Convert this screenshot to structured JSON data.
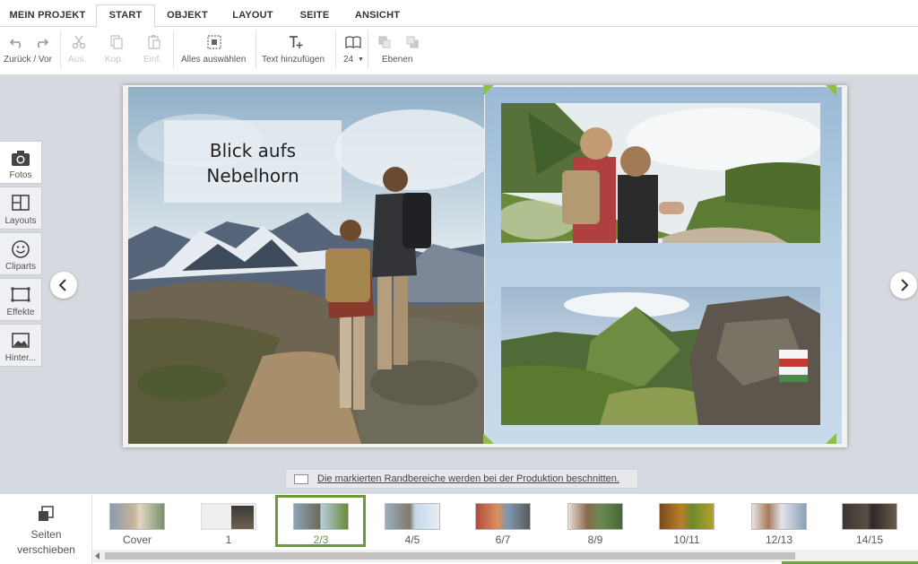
{
  "menu": {
    "tabs": [
      {
        "label": "MEIN PROJEKT",
        "active": false
      },
      {
        "label": "START",
        "active": true
      },
      {
        "label": "OBJEKT",
        "active": false
      },
      {
        "label": "LAYOUT",
        "active": false
      },
      {
        "label": "SEITE",
        "active": false
      },
      {
        "label": "ANSICHT",
        "active": false
      }
    ]
  },
  "toolbar": {
    "undo_redo_label": "Zurück / Vor",
    "cut_label": "Aus.",
    "copy_label": "Kop.",
    "paste_label": "Einf.",
    "select_all_label": "Alles auswählen",
    "add_text_label": "Text hinzufügen",
    "font_size_value": "24",
    "layers_label": "Ebenen"
  },
  "side_panel": {
    "items": [
      {
        "label": "Fotos",
        "icon": "camera-icon",
        "active": true
      },
      {
        "label": "Layouts",
        "icon": "layouts-icon",
        "active": false
      },
      {
        "label": "Cliparts",
        "icon": "smiley-icon",
        "active": false
      },
      {
        "label": "Effekte",
        "icon": "frame-icon",
        "active": false
      },
      {
        "label": "Hinter...",
        "icon": "background-icon",
        "active": false
      }
    ]
  },
  "spread": {
    "caption_line1": "Blick aufs",
    "caption_line2": "Nebelhorn"
  },
  "trim_notice": "Die markierten Randbereiche werden bei der Produktion beschnitten.",
  "page_strip": {
    "move_pages_line1": "Seiten",
    "move_pages_line2": "verschieben",
    "thumbs": [
      {
        "label": "Cover",
        "selected": false
      },
      {
        "label": "1",
        "selected": false
      },
      {
        "label": "2/3",
        "selected": true
      },
      {
        "label": "4/5",
        "selected": false
      },
      {
        "label": "6/7",
        "selected": false
      },
      {
        "label": "8/9",
        "selected": false
      },
      {
        "label": "10/11",
        "selected": false
      },
      {
        "label": "12/13",
        "selected": false
      },
      {
        "label": "14/15",
        "selected": false
      }
    ]
  },
  "colors": {
    "accent_green": "#6a9a3a",
    "workspace_bg": "#d6d9df",
    "page_bg": "#a9c4dc"
  }
}
